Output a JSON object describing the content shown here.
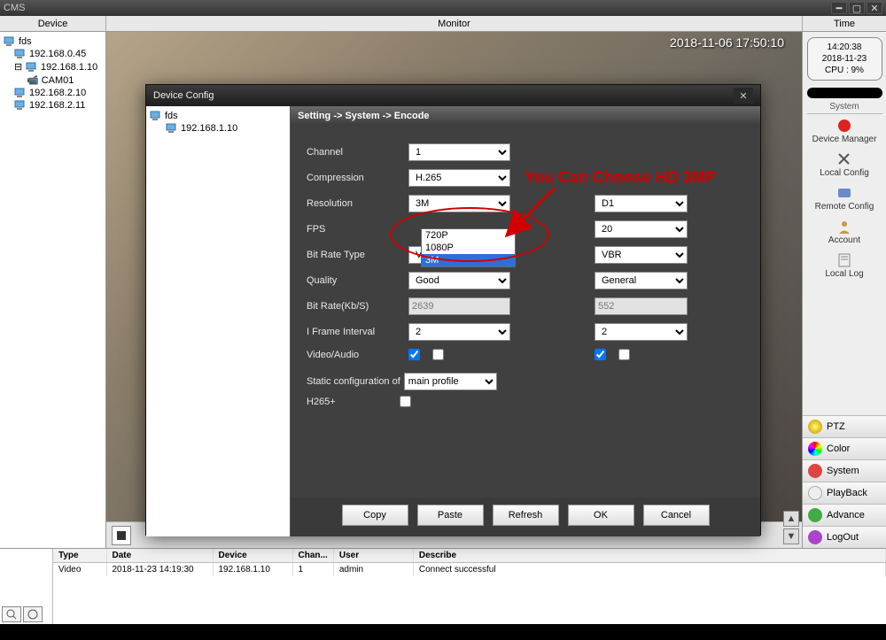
{
  "app_title": "CMS",
  "topbar": {
    "device": "Device",
    "monitor": "Monitor",
    "time": "Time"
  },
  "clock": {
    "time": "14:20:38",
    "date": "2018-11-23",
    "cpu": "CPU : 9%"
  },
  "sidebar_header": "System",
  "sidebar_items": {
    "devmgr": "Device Manager",
    "localcfg": "Local Config",
    "remotecfg": "Remote Config",
    "account": "Account",
    "locallog": "Local Log"
  },
  "side_tabs": {
    "ptz": "PTZ",
    "color": "Color",
    "system": "System",
    "playback": "PlayBack",
    "advance": "Advance",
    "logout": "LogOut"
  },
  "tree": {
    "root": "fds",
    "items": [
      "192.168.0.45",
      "192.168.1.10",
      "CAM01",
      "192.168.2.10",
      "192.168.2.11"
    ]
  },
  "osd": "2018-11-06  17:50:10",
  "log_headers": {
    "type": "Type",
    "date": "Date",
    "device": "Device",
    "chan": "Chan...",
    "user": "User",
    "describe": "Describe"
  },
  "log_row": {
    "type": "Video",
    "date": "2018-11-23 14:19:30",
    "device": "192.168.1.10",
    "chan": "1",
    "user": "admin",
    "describe": "Connect successful"
  },
  "dialog": {
    "title": "Device Config",
    "tree_root": "fds",
    "tree_ip": "192.168.1.10",
    "crumb": "Setting -> System -> Encode",
    "labels": {
      "channel": "Channel",
      "compression": "Compression",
      "resolution": "Resolution",
      "fps": "FPS",
      "brtype": "Bit Rate Type",
      "quality": "Quality",
      "bitrate": "Bit Rate(Kb/S)",
      "iframe": "I Frame Interval",
      "va": "Video/Audio",
      "static": "Static configuration of",
      "h265": "H265+"
    },
    "values": {
      "channel": "1",
      "compression": "H.265",
      "resolution": "3M",
      "fps_main": "",
      "fps_sub_res": "D1",
      "fps_sub": "20",
      "brtype_main": "VBR",
      "brtype_sub": "VBR",
      "quality_main": "Good",
      "quality_sub": "General",
      "bitrate_main": "2639",
      "bitrate_sub": "552",
      "iframe_main": "2",
      "iframe_sub": "2",
      "static": "main profile"
    },
    "res_options": [
      "720P",
      "1080P",
      "3M"
    ],
    "buttons": {
      "copy": "Copy",
      "paste": "Paste",
      "refresh": "Refresh",
      "ok": "OK",
      "cancel": "Cancel"
    }
  },
  "annotation": "You Can Choose HD 3MP"
}
